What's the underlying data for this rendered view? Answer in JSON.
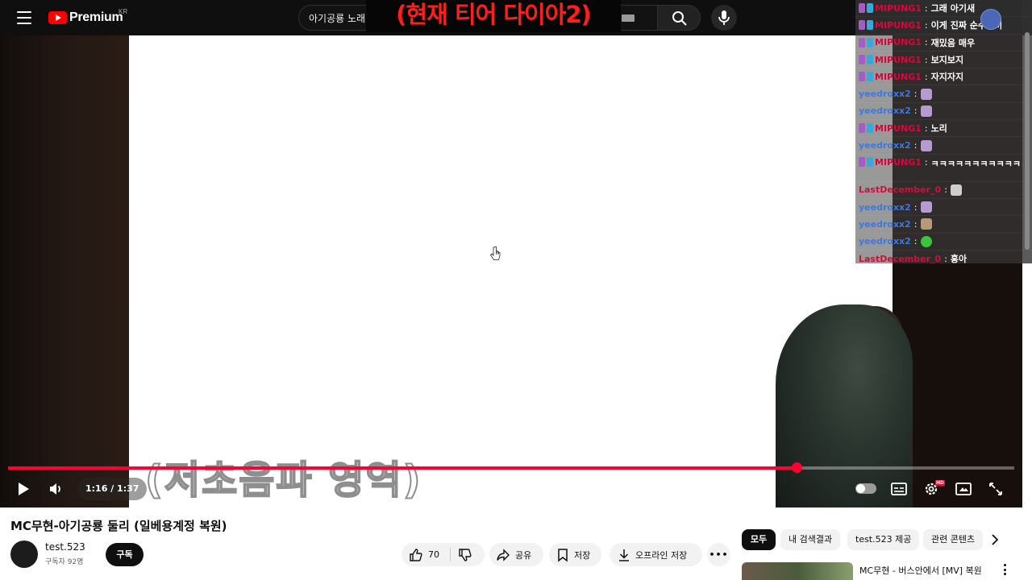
{
  "header": {
    "logo_text": "Premium",
    "logo_region": "KR",
    "search_value": "아기공룡 노래",
    "overlay_banner": "(현재 티어 다이아2)"
  },
  "player": {
    "caption_overlay": "(저초음파 영역)",
    "time_display": "1:16 / 1:37",
    "progress_fraction": 0.7835,
    "hd_badge": "HD",
    "accent_color": "#ff0033"
  },
  "chat": {
    "messages": [
      {
        "user": "MIPUNG1",
        "text": "그래 아기새",
        "color": "red",
        "badges": true
      },
      {
        "user": "MIPUNG1",
        "text": "이게 진짜 순수재미",
        "color": "red",
        "badges": true
      },
      {
        "user": "MIPUNG1",
        "text": "재밌음 매우",
        "color": "red",
        "badges": true
      },
      {
        "user": "MIPUNG1",
        "text": "보지보지",
        "color": "red",
        "badges": true
      },
      {
        "user": "MIPUNG1",
        "text": "자지자지",
        "color": "red",
        "badges": true
      },
      {
        "user": "yeedroxx2",
        "text": "",
        "color": "blue",
        "badges": false,
        "emote": "person"
      },
      {
        "user": "yeedroxx2",
        "text": "",
        "color": "blue",
        "badges": false,
        "emote": "person"
      },
      {
        "user": "MIPUNG1",
        "text": "노리",
        "color": "red",
        "badges": true
      },
      {
        "user": "yeedroxx2",
        "text": "",
        "color": "blue",
        "badges": false,
        "emote": "person"
      },
      {
        "user": "MIPUNG1",
        "text": "ㅋㅋㅋㅋㅋㅋㅋㅋㅋㅋㅋ",
        "color": "red",
        "badges": true,
        "tall": true
      },
      {
        "user": "LastDecember_0",
        "text": "",
        "color": "red2",
        "badges": false,
        "emote": "gray"
      },
      {
        "user": "yeedroxx2",
        "text": "",
        "color": "blue",
        "badges": false,
        "emote": "person"
      },
      {
        "user": "yeedroxx2",
        "text": "",
        "color": "blue",
        "badges": false,
        "emote": "face"
      },
      {
        "user": "yeedroxx2",
        "text": "",
        "color": "blue",
        "badges": false,
        "emote": "green"
      },
      {
        "user": "LastDecember_0",
        "text": "홍아",
        "color": "red2",
        "badges": false
      }
    ]
  },
  "video": {
    "title": "MC무현-아기공룡 둘리 (일베용계정 복원)",
    "channel_name": "test.523",
    "subscribers": "구독자 92명",
    "subscribe_label": "구독",
    "like_count": "70",
    "share_label": "공유",
    "save_label": "저장",
    "offline_label": "오프라인 저장",
    "more_label": "•••"
  },
  "sidebar": {
    "chips": [
      "모두",
      "내 검색결과",
      "test.523 제공",
      "관련 콘텐츠"
    ],
    "recommended": [
      {
        "title": "MC무현 - 버스안에서 [MV] 복원"
      }
    ]
  }
}
